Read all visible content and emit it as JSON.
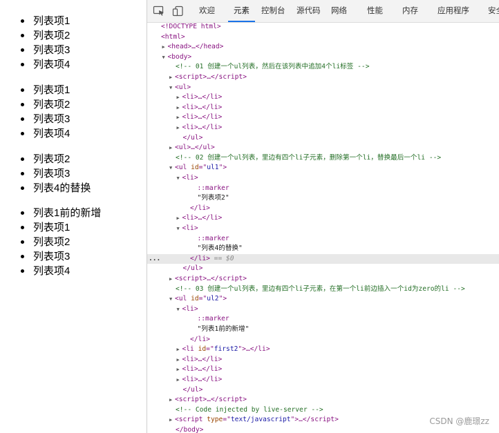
{
  "page": {
    "lists": [
      [
        "列表项1",
        "列表项2",
        "列表项3",
        "列表项4"
      ],
      [
        "列表项1",
        "列表项2",
        "列表项3",
        "列表项4"
      ],
      [
        "列表项2",
        "列表项3",
        "列表4的替换"
      ],
      [
        "列表1前的新增",
        "列表项1",
        "列表项2",
        "列表项3",
        "列表项4"
      ]
    ]
  },
  "devtools": {
    "tabs": [
      "欢迎",
      "元素",
      "控制台",
      "源代码",
      "网络",
      "性能",
      "内存",
      "应用程序",
      "安全"
    ],
    "active_tab": "元素",
    "lines": [
      {
        "d": 0,
        "t": "",
        "h": "<span class=\"tag\">&lt;!DOCTYPE html&gt;</span>"
      },
      {
        "d": 0,
        "t": "",
        "h": "<span class=\"tag\">&lt;html&gt;</span>"
      },
      {
        "d": 1,
        "t": "▶",
        "h": "<span class=\"tag\">&lt;head&gt;</span>…<span class=\"tag\">&lt;/head&gt;</span>"
      },
      {
        "d": 1,
        "t": "▼",
        "h": "<span class=\"tag\">&lt;body&gt;</span>"
      },
      {
        "d": 2,
        "t": "",
        "h": "<span class=\"comment\">&lt;!-- 01 创建一个ul列表，然后在该列表中追加4个li标签 --&gt;</span>"
      },
      {
        "d": 2,
        "t": "▶",
        "h": "<span class=\"tag\">&lt;script&gt;</span>…<span class=\"tag\">&lt;/script&gt;</span>"
      },
      {
        "d": 2,
        "t": "▼",
        "h": "<span class=\"tag\">&lt;ul&gt;</span>"
      },
      {
        "d": 3,
        "t": "▶",
        "h": "<span class=\"tag\">&lt;li&gt;</span>…<span class=\"tag\">&lt;/li&gt;</span>"
      },
      {
        "d": 3,
        "t": "▶",
        "h": "<span class=\"tag\">&lt;li&gt;</span>…<span class=\"tag\">&lt;/li&gt;</span>"
      },
      {
        "d": 3,
        "t": "▶",
        "h": "<span class=\"tag\">&lt;li&gt;</span>…<span class=\"tag\">&lt;/li&gt;</span>"
      },
      {
        "d": 3,
        "t": "▶",
        "h": "<span class=\"tag\">&lt;li&gt;</span>…<span class=\"tag\">&lt;/li&gt;</span>"
      },
      {
        "d": 3,
        "t": "",
        "h": "<span class=\"tag\">&lt;/ul&gt;</span>"
      },
      {
        "d": 2,
        "t": "▶",
        "h": "<span class=\"tag\">&lt;ul&gt;</span>…<span class=\"tag\">&lt;/ul&gt;</span>"
      },
      {
        "d": 2,
        "t": "",
        "h": "<span class=\"comment\">&lt;!-- 02  创建一个ul列表，里边有四个li子元素，删除第一个li，替换最后一个li --&gt;</span>"
      },
      {
        "d": 2,
        "t": "▼",
        "h": "<span class=\"tag\">&lt;ul </span><span class=\"attr-name\">id</span><span class=\"tag\">=\"</span><span class=\"attr-val\">ul1</span><span class=\"tag\">\"&gt;</span>"
      },
      {
        "d": 3,
        "t": "▼",
        "h": "<span class=\"tag\">&lt;li&gt;</span>"
      },
      {
        "d": 5,
        "t": "",
        "h": "<span class=\"marker\">::marker</span>"
      },
      {
        "d": 5,
        "t": "",
        "h": "<span class=\"text\">\"列表项2\"</span>"
      },
      {
        "d": 4,
        "t": "",
        "h": "<span class=\"tag\">&lt;/li&gt;</span>"
      },
      {
        "d": 3,
        "t": "▶",
        "h": "<span class=\"tag\">&lt;li&gt;</span>…<span class=\"tag\">&lt;/li&gt;</span>"
      },
      {
        "d": 3,
        "t": "▼",
        "h": "<span class=\"tag\">&lt;li&gt;</span>"
      },
      {
        "d": 5,
        "t": "",
        "h": "<span class=\"marker\">::marker</span>"
      },
      {
        "d": 5,
        "t": "",
        "h": "<span class=\"text\">\"列表4的替换\"</span>"
      },
      {
        "d": 4,
        "t": "",
        "sel": true,
        "h": "<span class=\"tag\">&lt;/li&gt;</span> <span class=\"eq\">== $0</span>"
      },
      {
        "d": 3,
        "t": "",
        "h": "<span class=\"tag\">&lt;/ul&gt;</span>"
      },
      {
        "d": 2,
        "t": "▶",
        "h": "<span class=\"tag\">&lt;script&gt;</span>…<span class=\"tag\">&lt;/script&gt;</span>"
      },
      {
        "d": 2,
        "t": "",
        "h": "<span class=\"comment\">&lt;!-- 03  创建一个ul列表，里边有四个li子元素，在第一个li前边插入一个id为zero的li --&gt;</span>"
      },
      {
        "d": 2,
        "t": "▼",
        "h": "<span class=\"tag\">&lt;ul </span><span class=\"attr-name\">id</span><span class=\"tag\">=\"</span><span class=\"attr-val\">ul2</span><span class=\"tag\">\"&gt;</span>"
      },
      {
        "d": 3,
        "t": "▼",
        "h": "<span class=\"tag\">&lt;li&gt;</span>"
      },
      {
        "d": 5,
        "t": "",
        "h": "<span class=\"marker\">::marker</span>"
      },
      {
        "d": 5,
        "t": "",
        "h": "<span class=\"text\">\"列表1前的新增\"</span>"
      },
      {
        "d": 4,
        "t": "",
        "h": "<span class=\"tag\">&lt;/li&gt;</span>"
      },
      {
        "d": 3,
        "t": "▶",
        "h": "<span class=\"tag\">&lt;li </span><span class=\"attr-name\">id</span><span class=\"tag\">=\"</span><span class=\"attr-val\">first2</span><span class=\"tag\">\"&gt;</span>…<span class=\"tag\">&lt;/li&gt;</span>"
      },
      {
        "d": 3,
        "t": "▶",
        "h": "<span class=\"tag\">&lt;li&gt;</span>…<span class=\"tag\">&lt;/li&gt;</span>"
      },
      {
        "d": 3,
        "t": "▶",
        "h": "<span class=\"tag\">&lt;li&gt;</span>…<span class=\"tag\">&lt;/li&gt;</span>"
      },
      {
        "d": 3,
        "t": "▶",
        "h": "<span class=\"tag\">&lt;li&gt;</span>…<span class=\"tag\">&lt;/li&gt;</span>"
      },
      {
        "d": 3,
        "t": "",
        "h": "<span class=\"tag\">&lt;/ul&gt;</span>"
      },
      {
        "d": 2,
        "t": "▶",
        "h": "<span class=\"tag\">&lt;script&gt;</span>…<span class=\"tag\">&lt;/script&gt;</span>"
      },
      {
        "d": 2,
        "t": "",
        "h": "<span class=\"comment\">&lt;!-- Code injected by live-server --&gt;</span>"
      },
      {
        "d": 2,
        "t": "▶",
        "h": "<span class=\"tag\">&lt;script </span><span class=\"attr-name\">type</span><span class=\"tag\">=\"</span><span class=\"attr-val\">text/javascript</span><span class=\"tag\">\"&gt;</span>…<span class=\"tag\">&lt;/script&gt;</span>"
      },
      {
        "d": 2,
        "t": "",
        "h": "<span class=\"tag\">&lt;/body&gt;</span>"
      }
    ],
    "selected_marker": "..."
  },
  "watermark": "CSDN @鹿璟zz"
}
